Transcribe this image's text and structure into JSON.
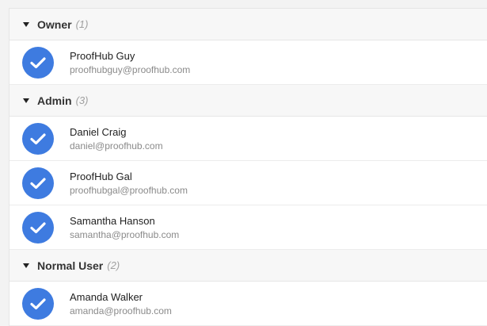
{
  "colors": {
    "accent": "#3e7be0",
    "header_bg": "#f7f7f7",
    "muted_text": "#8a8a8a"
  },
  "groups": [
    {
      "name": "Owner",
      "count": "(1)",
      "users": [
        {
          "name": "ProofHub Guy",
          "email": "proofhubguy@proofhub.com",
          "avatar_icon": "check-circle-icon"
        }
      ]
    },
    {
      "name": "Admin",
      "count": "(3)",
      "users": [
        {
          "name": "Daniel Craig",
          "email": "daniel@proofhub.com",
          "avatar_icon": "check-circle-icon"
        },
        {
          "name": "ProofHub Gal",
          "email": "proofhubgal@proofhub.com",
          "avatar_icon": "check-circle-icon"
        },
        {
          "name": "Samantha Hanson",
          "email": "samantha@proofhub.com",
          "avatar_icon": "check-circle-icon"
        }
      ]
    },
    {
      "name": "Normal User",
      "count": "(2)",
      "users": [
        {
          "name": "Amanda Walker",
          "email": "amanda@proofhub.com",
          "avatar_icon": "check-circle-icon"
        }
      ]
    }
  ]
}
